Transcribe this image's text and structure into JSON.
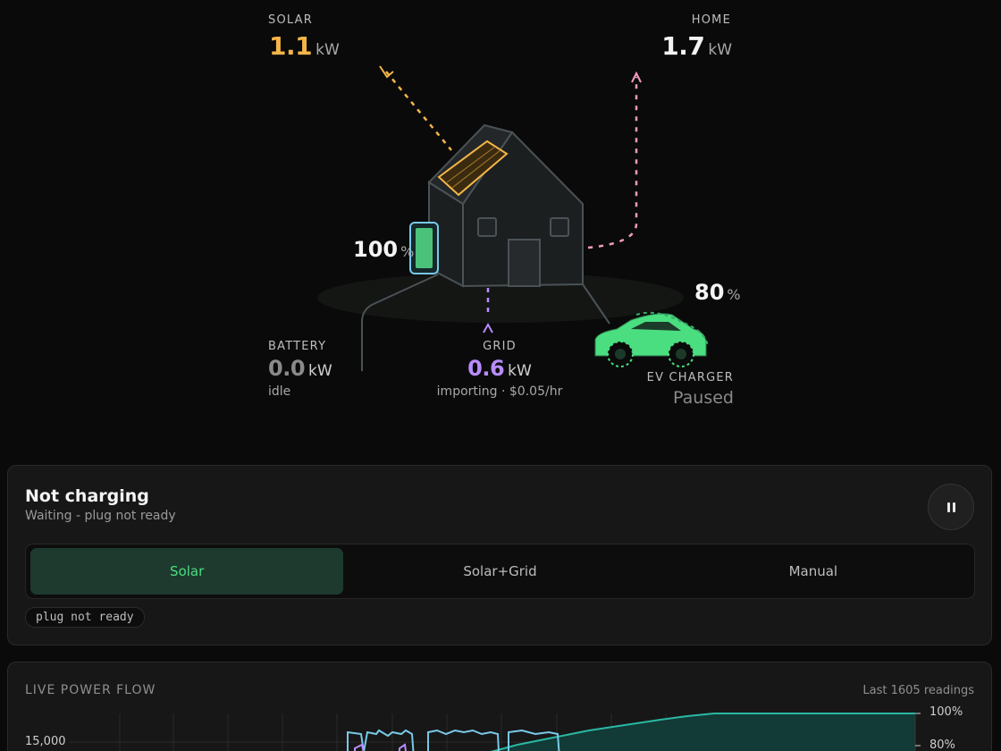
{
  "colors": {
    "solar": "#f4b548",
    "grid": "#b88cff",
    "home": "#f29bbd",
    "battery": "#4ac27a",
    "ev": "#4ade80",
    "accent": "#4ade80"
  },
  "flow": {
    "solar": {
      "label": "SOLAR",
      "value": "1.1",
      "unit": "kW"
    },
    "home": {
      "label": "HOME",
      "value": "1.7",
      "unit": "kW"
    },
    "battery": {
      "label": "BATTERY",
      "value": "0.0",
      "unit": "kW",
      "status": "idle",
      "soc": "100",
      "soc_unit": "%",
      "level": 1.0
    },
    "grid": {
      "label": "GRID",
      "value": "0.6",
      "unit": "kW",
      "status": "importing · $0.05/hr"
    },
    "ev": {
      "label": "EV CHARGER",
      "status": "Paused",
      "soc": "80",
      "soc_unit": "%"
    }
  },
  "charging": {
    "title": "Not charging",
    "subtitle": "Waiting - plug not ready",
    "pause_icon": "pause-icon",
    "modes": [
      {
        "label": "Solar",
        "active": true
      },
      {
        "label": "Solar+Grid",
        "active": false
      },
      {
        "label": "Manual",
        "active": false
      }
    ],
    "tag": "plug not ready"
  },
  "live": {
    "title": "LIVE POWER FLOW",
    "count": "Last 1605 readings",
    "y_left_tick": "15,000",
    "y_right_ticks": [
      "100%",
      "80%"
    ]
  }
}
